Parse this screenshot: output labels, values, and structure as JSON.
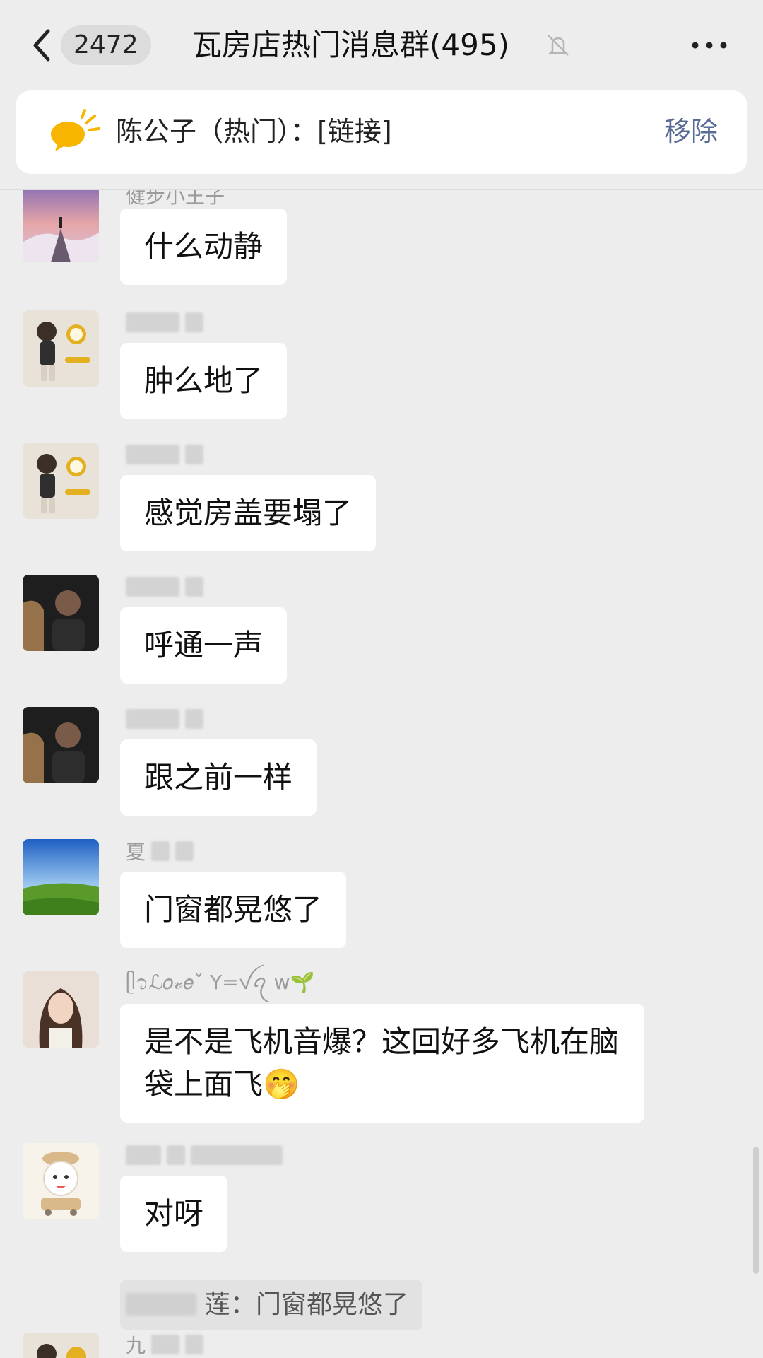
{
  "header": {
    "unread_count": "2472",
    "title": "瓦房店热门消息群(495)",
    "back_icon": "chevron-left-icon",
    "mute_icon": "bell-off-icon",
    "more_icon": "more-dots-icon"
  },
  "pinned": {
    "icon": "megaphone-icon",
    "text": "陈公子（热门）：[链接]",
    "remove_label": "移除"
  },
  "messages": [
    {
      "nickname": "健步小王子",
      "text": "什么动静"
    },
    {
      "nickname": "",
      "text": "肿么地了"
    },
    {
      "nickname": "",
      "text": "感觉房盖要塌了"
    },
    {
      "nickname": "",
      "text": "呼通一声"
    },
    {
      "nickname": "",
      "text": "跟之前一样"
    },
    {
      "nickname": "夏",
      "text": "门窗都晃悠了"
    },
    {
      "nickname": "ᥫ᭡ℒ𝑜𝓋𝑒ˇ Y=ꪜꪖ w🌱",
      "text": "是不是飞机音爆？这回好多飞机在脑袋上面飞🤭"
    },
    {
      "nickname": "",
      "text": "对呀",
      "quote": "莲：门窗都晃悠了"
    },
    {
      "nickname": "九",
      "text": ""
    }
  ],
  "colors": {
    "background": "#ededed",
    "bubble": "#ffffff",
    "link_blue": "#576b95",
    "nickname_gray": "#9b9b9b"
  }
}
